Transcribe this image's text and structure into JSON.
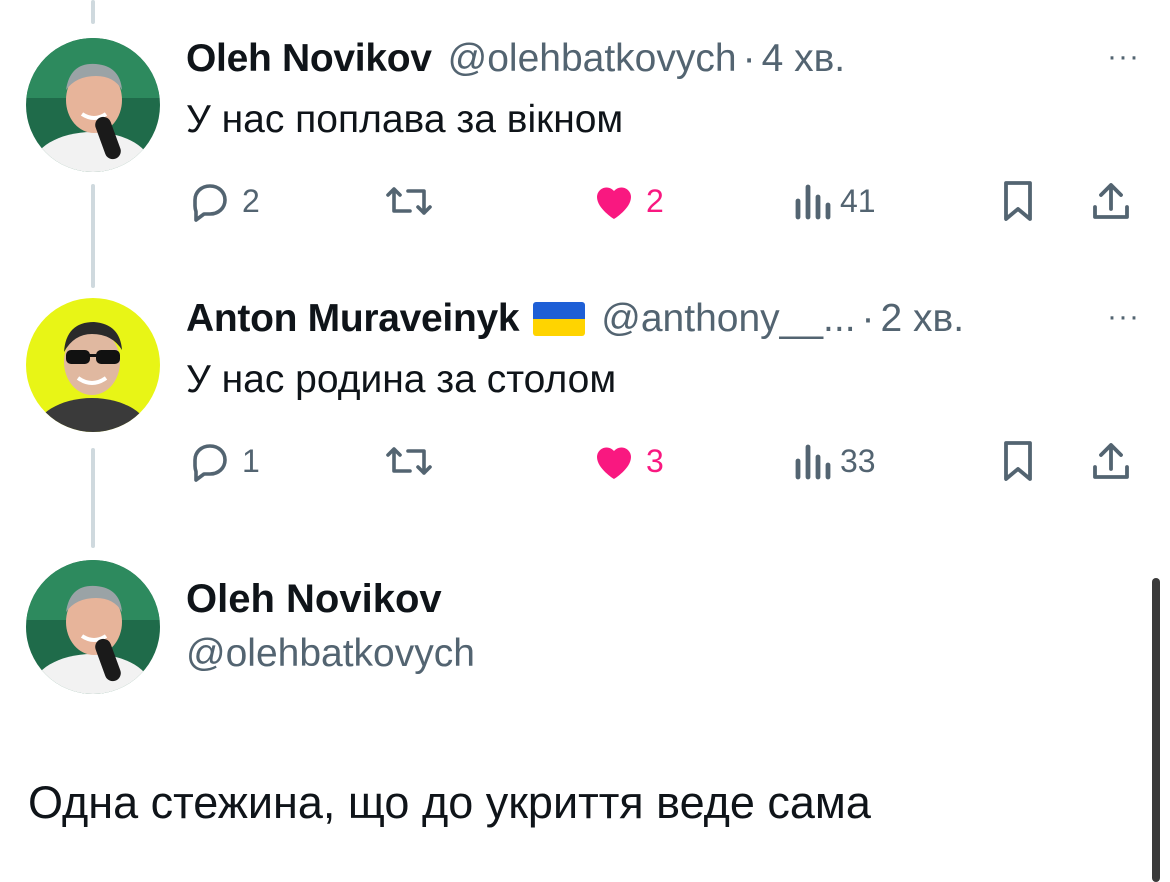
{
  "tweets": [
    {
      "name": "Oleh Novikov",
      "handle": "@olehbatkovych",
      "dot": "·",
      "time": "4 хв.",
      "more": "···",
      "text": "У нас поплава за вікном",
      "replies": "2",
      "likes": "2",
      "views": "41"
    },
    {
      "name": "Anton Muraveinyk",
      "handle": "@anthony__...",
      "dot": "·",
      "time": "2 хв.",
      "more": "···",
      "text": "У нас родина за столом",
      "replies": "1",
      "likes": "3",
      "views": "33"
    }
  ],
  "focus": {
    "name": "Oleh Novikov",
    "handle": "@olehbatkovych",
    "text": "Одна стежина, що до укриття веде сама"
  },
  "colors": {
    "like": "#f91880",
    "muted": "#536471",
    "thread_line": "#cfd9de",
    "avatar_yellow": "#e8f516"
  },
  "icons": [
    "reply-icon",
    "retweet-icon",
    "heart-icon",
    "views-icon",
    "bookmark-icon",
    "share-icon",
    "ua-flag-icon"
  ]
}
